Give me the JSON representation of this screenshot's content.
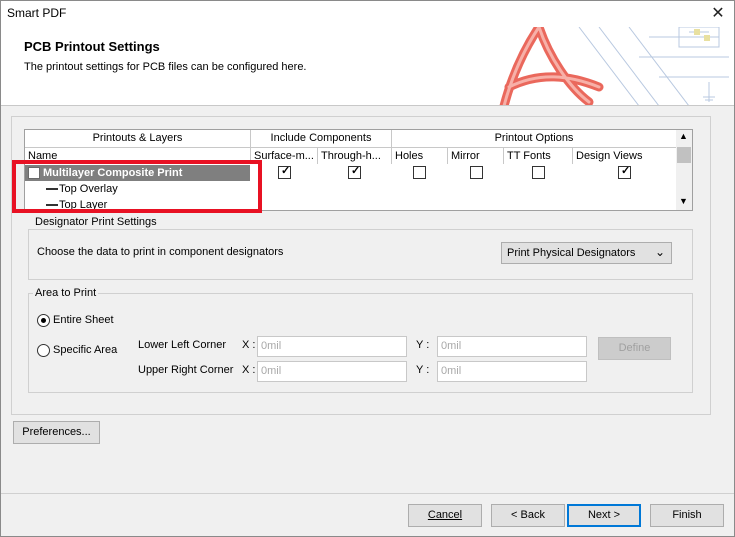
{
  "window": {
    "title": "Smart PDF",
    "close_glyph": "✕"
  },
  "header": {
    "title": "PCB Printout Settings",
    "subtitle": "The printout settings for PCB files can be configured here."
  },
  "layers_table": {
    "group_headers": {
      "printouts_layers": "Printouts & Layers",
      "include_components": "Include Components",
      "printout_options": "Printout Options"
    },
    "columns": [
      "Name",
      "Surface-m...",
      "Through-h...",
      "Holes",
      "Mirror",
      "TT Fonts",
      "Design Views"
    ],
    "rows": [
      {
        "name": "Multilayer Composite Print",
        "selected": true,
        "surface": true,
        "through": true,
        "holes": false,
        "mirror": false,
        "ttfonts": false,
        "designviews": true
      },
      {
        "name": "Top Overlay",
        "selected": false
      },
      {
        "name": "Top Layer",
        "selected": false
      }
    ]
  },
  "designator": {
    "legend": "Designator Print Settings",
    "prompt": "Choose the data to print in component designators",
    "selected_option": "Print Physical Designators"
  },
  "area": {
    "legend": "Area to Print",
    "entire_sheet": "Entire Sheet",
    "specific_area": "Specific Area",
    "entire_sheet_selected": true,
    "lower_left_label": "Lower Left Corner",
    "upper_right_label": "Upper Right Corner",
    "x_label": "X :",
    "y_label": "Y :",
    "ll_x": "0mil",
    "ll_y": "0mil",
    "ur_x": "0mil",
    "ur_y": "0mil",
    "define_button": "Define"
  },
  "buttons": {
    "preferences": "Preferences...",
    "cancel": "Cancel",
    "back": "< Back",
    "next": "Next >",
    "finish": "Finish"
  },
  "colors": {
    "highlight_box": "#e81123",
    "selected_row": "#7f7f7f",
    "default_button_border": "#0078d7",
    "acrobat_red": "#e8584a"
  }
}
